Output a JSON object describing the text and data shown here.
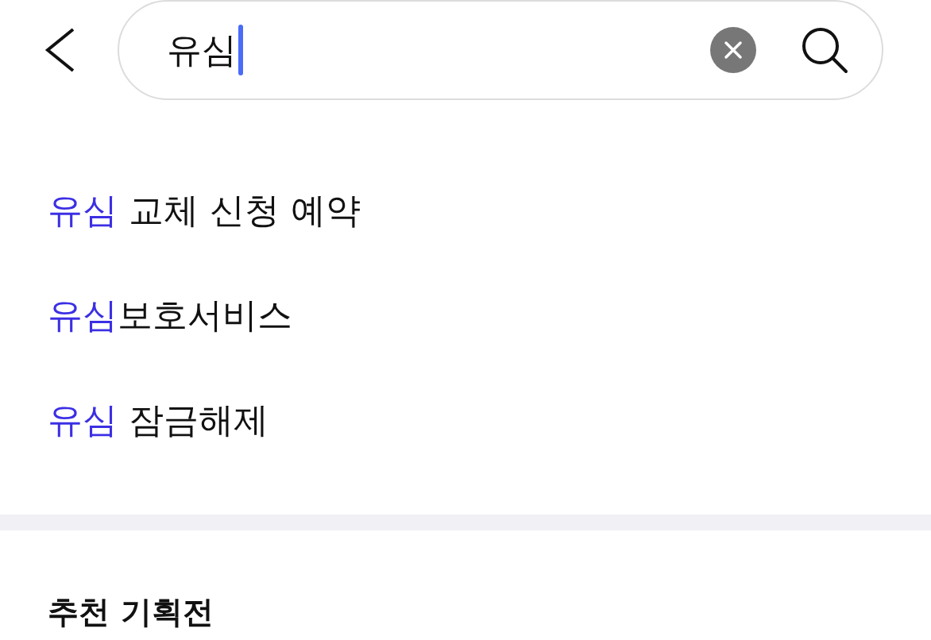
{
  "search": {
    "value": "유심"
  },
  "suggestions": [
    {
      "match": "유심",
      "rest": " 교체 신청 예약"
    },
    {
      "match": "유심",
      "rest": "보호서비스"
    },
    {
      "match": "유심",
      "rest": " 잠금해제"
    }
  ],
  "section": {
    "title": "추천 기획전"
  }
}
